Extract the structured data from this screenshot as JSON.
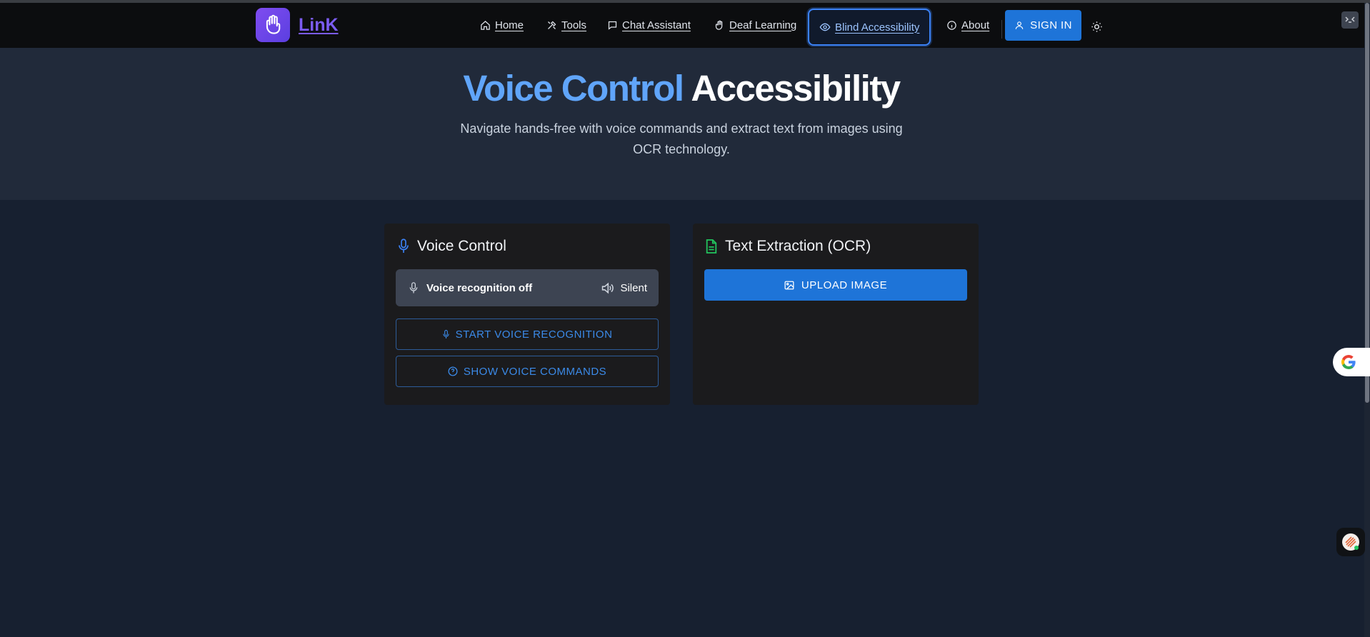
{
  "brand": {
    "name": "LinK"
  },
  "nav": {
    "items": [
      {
        "label": "Home",
        "icon": "home-icon"
      },
      {
        "label": "Tools",
        "icon": "tools-icon"
      },
      {
        "label": "Chat Assistant",
        "icon": "chat-icon"
      },
      {
        "label": "Deaf Learning",
        "icon": "hand-icon"
      },
      {
        "label": "Blind Accessibility",
        "icon": "eye-icon",
        "active": true
      },
      {
        "label": "About",
        "icon": "info-icon"
      }
    ],
    "signin_label": "SIGN IN"
  },
  "hero": {
    "title_accent": "Voice Control",
    "title_rest": "Accessibility",
    "subtitle": "Navigate hands-free with voice commands and extract text from images using OCR technology."
  },
  "voice_card": {
    "title": "Voice Control",
    "status_text": "Voice recognition off",
    "sound_text": "Silent",
    "start_label": "START VOICE RECOGNITION",
    "commands_label": "SHOW VOICE COMMANDS"
  },
  "ocr_card": {
    "title": "Text Extraction (OCR)",
    "upload_label": "UPLOAD IMAGE"
  },
  "colors": {
    "accent": "#60a5fa",
    "primary_button": "#1e74d8",
    "brand": "#7b5cf0",
    "ocr_icon": "#22c55e"
  }
}
